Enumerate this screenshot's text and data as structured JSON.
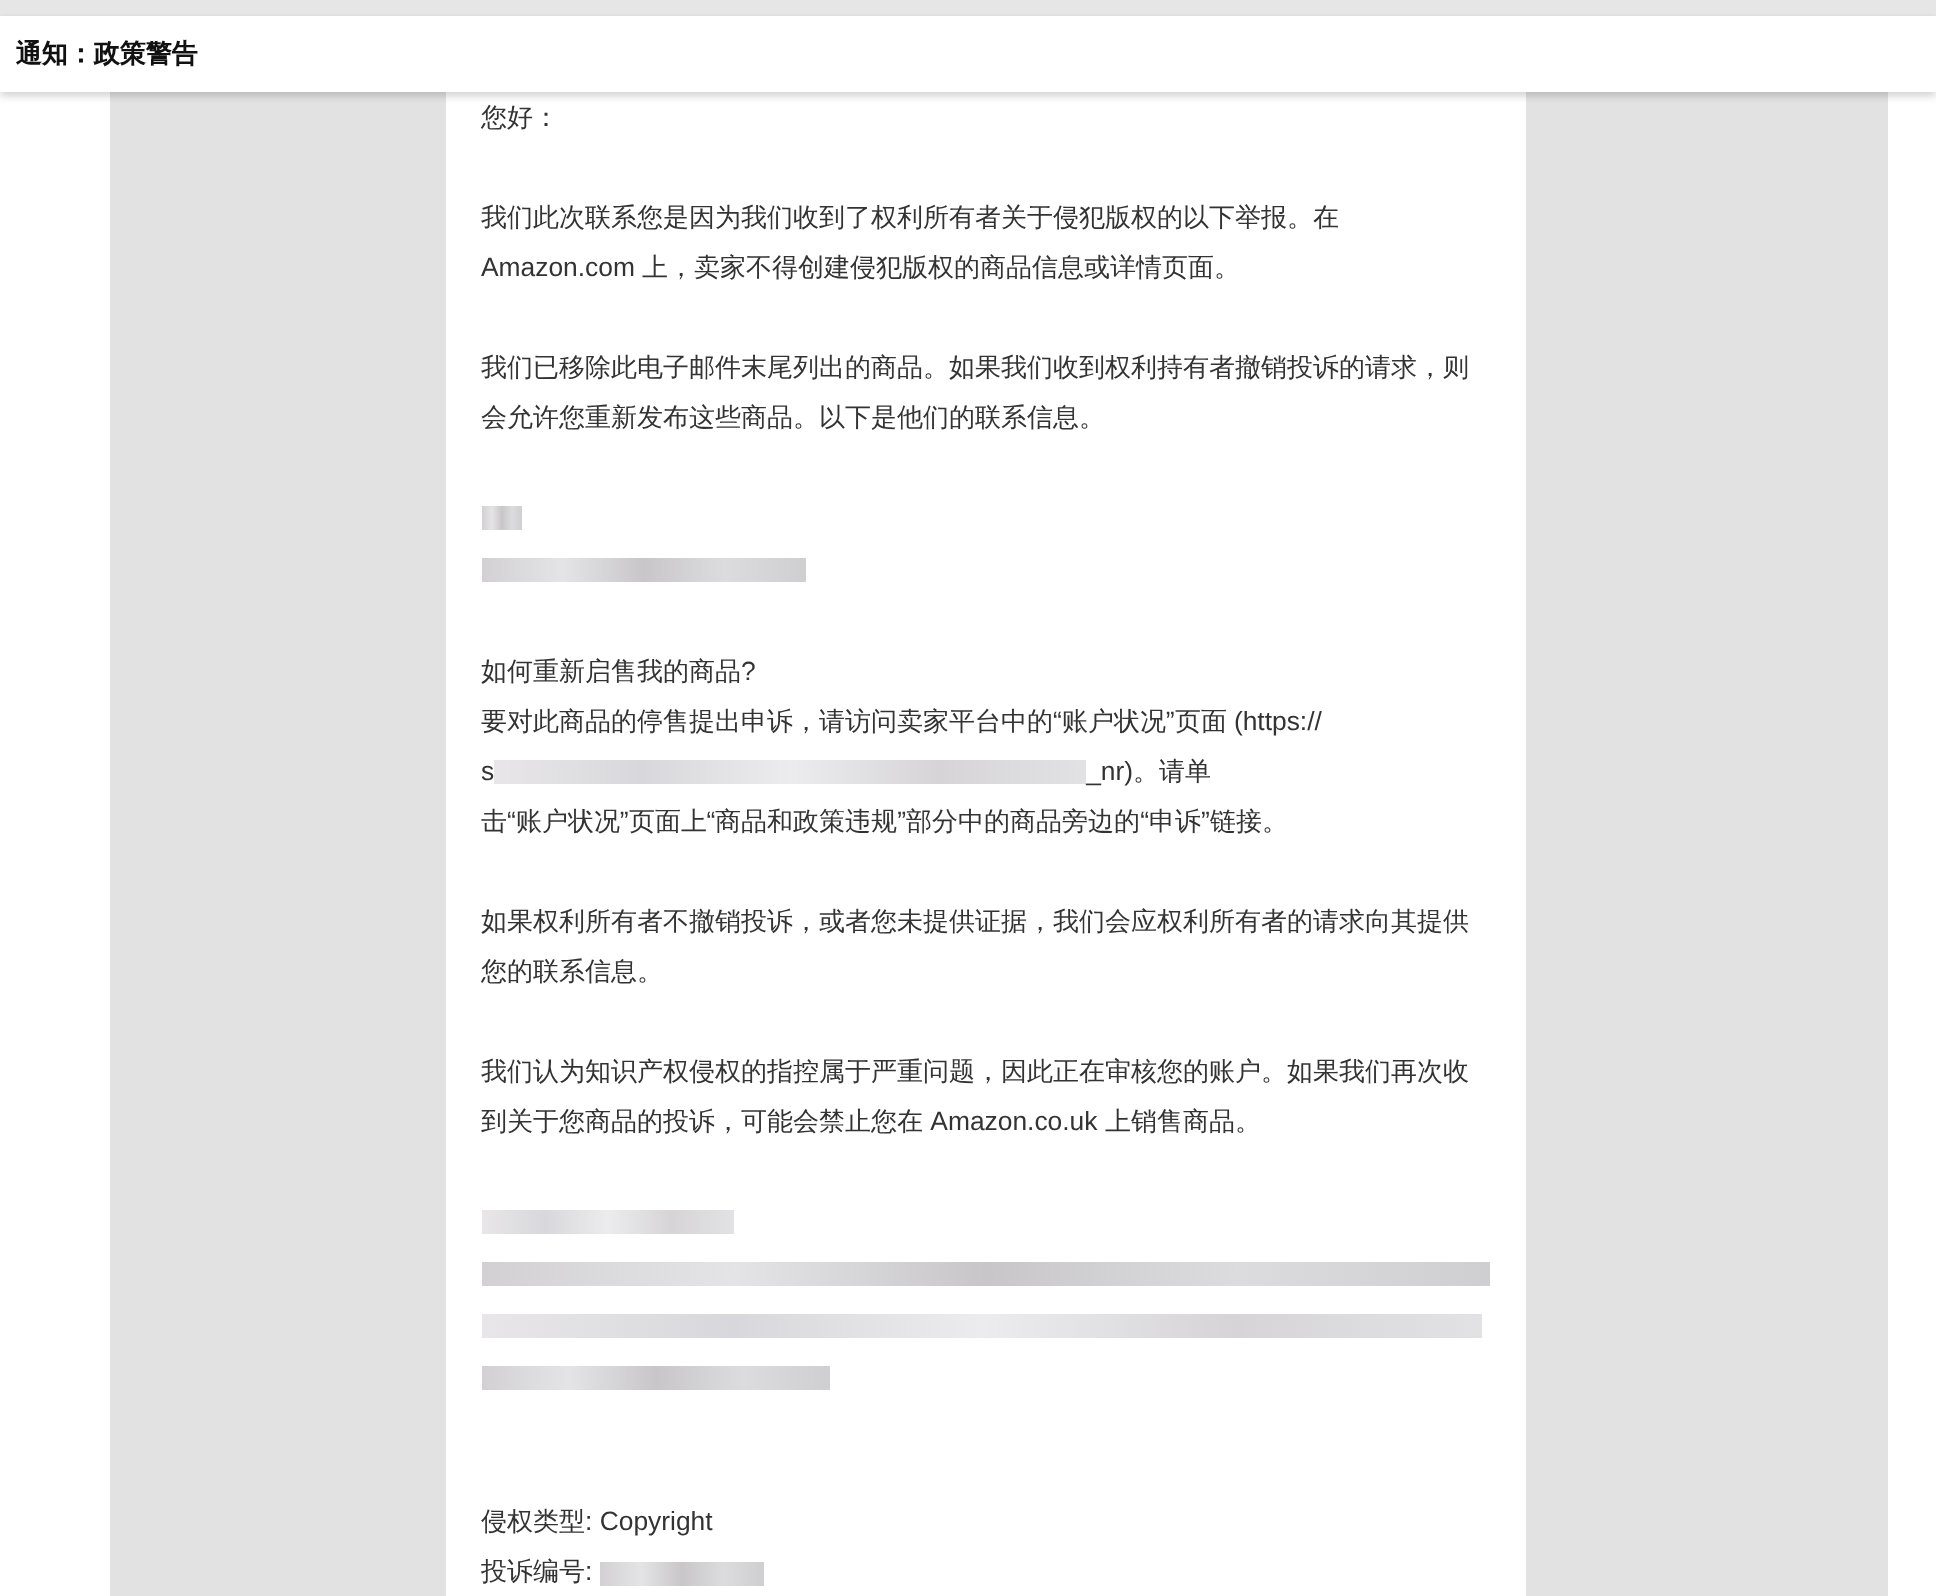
{
  "header": {
    "title": "通知：政策警告"
  },
  "email": {
    "blocks": [
      {
        "kind": "paragraph",
        "text": "您好："
      },
      {
        "kind": "paragraph",
        "text": "我们此次联系您是因为我们收到了权利所有者关于侵犯版权的以下举报。在 Amazon.com 上，卖家不得创建侵犯版权的商品信息或详情页面。"
      },
      {
        "kind": "paragraph",
        "text": "我们已移除此电子邮件末尾列出的商品。如果我们收到权利持有者撤销投诉的请求，则会允许您重新发布这些商品。以下是他们的联系信息。"
      },
      {
        "kind": "contact_redacted"
      },
      {
        "kind": "appeal",
        "heading": "如何重新启售我的商品?",
        "text_before": "要对此商品的停售提出申诉，请访问卖家平台中的“账户状况”页面 (https://",
        "url_start": "s",
        "url_end": "_nr)。请单",
        "text_after": "击“账户状况”页面上“商品和政策违规”部分中的商品旁边的“申诉”链接。"
      },
      {
        "kind": "paragraph",
        "text": "如果权利所有者不撤销投诉，或者您未提供证据，我们会应权利所有者的请求向其提供您的联系信息。"
      },
      {
        "kind": "paragraph",
        "text": "我们认为知识产权侵权的指控属于严重问题，因此正在审核您的账户。如果我们再次收到关于您商品的投诉，可能会禁止您在 Amazon.co.uk 上销售商品。"
      },
      {
        "kind": "signature_redacted"
      },
      {
        "kind": "field",
        "label": "侵权类型:",
        "value": "Copyright"
      },
      {
        "kind": "field_redacted",
        "label": "投诉编号:"
      }
    ]
  }
}
